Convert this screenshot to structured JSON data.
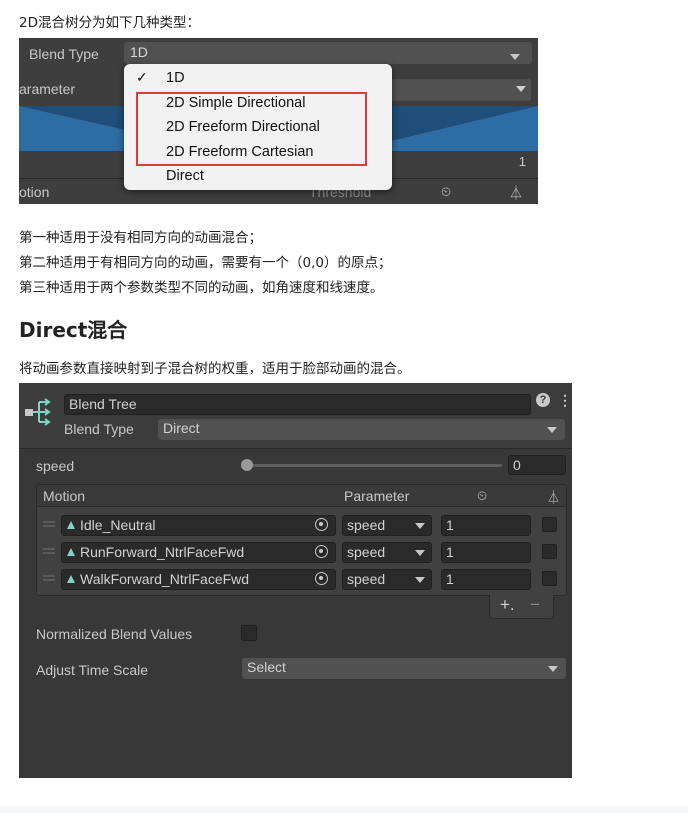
{
  "intro_text": "2D混合树分为如下几种类型：",
  "image1": {
    "blend_type_label": "Blend Type",
    "blend_type_value": "1D",
    "parameter_label": "arameter",
    "threshold_value": "1",
    "motion_label": "otion",
    "threshold_label": "Threshold",
    "dropdown_items": [
      "1D",
      "2D Simple Directional",
      "2D Freeform Directional",
      "2D Freeform Cartesian",
      "Direct"
    ],
    "dropdown_selected": "1D",
    "colors": {
      "highlight_box": "#e53935",
      "graph_fill": "#2e6da4"
    }
  },
  "explanations": [
    "第一种适用于没有相同方向的动画混合；",
    "第二种适用于有相同方向的动画，需要有一个（0,0）的原点；",
    "第三种适用于两个参数类型不同的动画，如角速度和线速度。"
  ],
  "section_heading": "Direct混合",
  "section_text": "将动画参数直接映射到子混合树的权重，适用于脸部动画的混合。",
  "image2": {
    "name_value": "Blend Tree",
    "blend_type_label": "Blend Type",
    "blend_type_value": "Direct",
    "speed_label": "speed",
    "speed_value": "0",
    "speed_slider_fraction": 0.0,
    "header": {
      "motion": "Motion",
      "parameter": "Parameter"
    },
    "rows": [
      {
        "motion": "Idle_Neutral",
        "parameter": "speed",
        "value": "1"
      },
      {
        "motion": "RunForward_NtrlFaceFwd",
        "parameter": "speed",
        "value": "1"
      },
      {
        "motion": "WalkForward_NtrlFaceFwd",
        "parameter": "speed",
        "value": "1"
      }
    ],
    "add_label": "+.",
    "remove_label": "−",
    "normalized_label": "Normalized Blend Values",
    "adjust_label": "Adjust Time Scale",
    "adjust_value": "Select",
    "icons": [
      "blend-tree-icon",
      "help-icon",
      "kebab-menu-icon",
      "time-icon",
      "mirror-icon",
      "animation-clip-icon",
      "object-picker-icon",
      "drag-handle-icon"
    ]
  }
}
